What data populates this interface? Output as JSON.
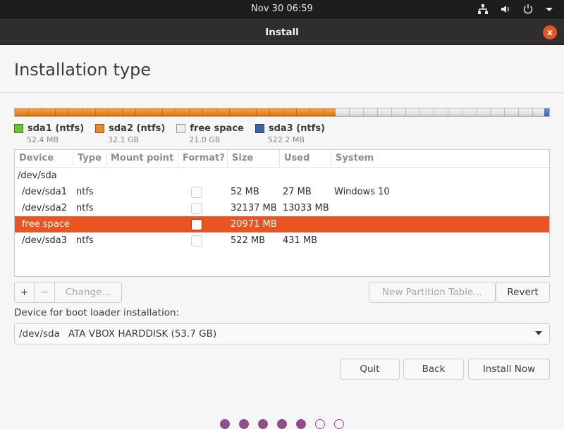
{
  "topbar": {
    "datetime": "Nov 30  06:59",
    "tray_icons": [
      "network-icon",
      "volume-icon",
      "power-icon",
      "menu-arrow-icon"
    ]
  },
  "window": {
    "title": "Install",
    "close_label": "x"
  },
  "page": {
    "heading": "Installation type"
  },
  "disk_usage": {
    "segments": [
      {
        "name": "sda1 (ntfs)",
        "size": "52.4 MB",
        "color": "#6ac42f",
        "mb": 52
      },
      {
        "name": "sda2 (ntfs)",
        "size": "32.1 GB",
        "color": "#ea8a26",
        "mb": 32137
      },
      {
        "name": "free space",
        "size": "21.0 GB",
        "color": "#eeeeee",
        "mb": 20971
      },
      {
        "name": "sda3 (ntfs)",
        "size": "522.2 MB",
        "color": "#3b66a6",
        "mb": 522
      }
    ]
  },
  "partition_table": {
    "columns": [
      "Device",
      "Type",
      "Mount point",
      "Format?",
      "Size",
      "Used",
      "System"
    ],
    "rows": [
      {
        "device": "/dev/sda",
        "type": "",
        "mount": "",
        "format": null,
        "size": "",
        "used": "",
        "system": "",
        "selected": false,
        "indent": false
      },
      {
        "device": "/dev/sda1",
        "type": "ntfs",
        "mount": "",
        "format": false,
        "size": "52 MB",
        "used": "27 MB",
        "system": "Windows 10",
        "selected": false,
        "indent": true
      },
      {
        "device": "/dev/sda2",
        "type": "ntfs",
        "mount": "",
        "format": false,
        "size": "32137 MB",
        "used": "13033 MB",
        "system": "",
        "selected": false,
        "indent": true
      },
      {
        "device": "free space",
        "type": "",
        "mount": "",
        "format": false,
        "size": "20971 MB",
        "used": "",
        "system": "",
        "selected": true,
        "indent": true
      },
      {
        "device": "/dev/sda3",
        "type": "ntfs",
        "mount": "",
        "format": false,
        "size": "522 MB",
        "used": "431 MB",
        "system": "",
        "selected": false,
        "indent": true
      }
    ]
  },
  "toolbar": {
    "add_label": "+",
    "remove_label": "−",
    "change_label": "Change...",
    "new_table_label": "New Partition Table...",
    "revert_label": "Revert"
  },
  "bootloader": {
    "label": "Device for boot loader installation:",
    "selected_device": "/dev/sda",
    "selected_desc": "ATA VBOX HARDDISK (53.7 GB)"
  },
  "actions": {
    "quit_label": "Quit",
    "back_label": "Back",
    "install_label": "Install Now"
  },
  "progress": {
    "total_steps": 7,
    "completed_steps": 5
  }
}
